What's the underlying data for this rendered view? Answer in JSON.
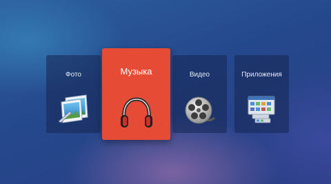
{
  "menu": {
    "items": [
      {
        "label": "Фото",
        "icon": "photo-icon",
        "selected": false
      },
      {
        "label": "Музыка",
        "icon": "headphones-icon",
        "selected": true
      },
      {
        "label": "Видео",
        "icon": "film-reel-icon",
        "selected": false
      },
      {
        "label": "Приложения",
        "icon": "apps-icon",
        "selected": false
      }
    ]
  },
  "colors": {
    "selected_tile": "#e54b35",
    "tile_background": "#1d3068",
    "background": "#2b4a8e"
  }
}
